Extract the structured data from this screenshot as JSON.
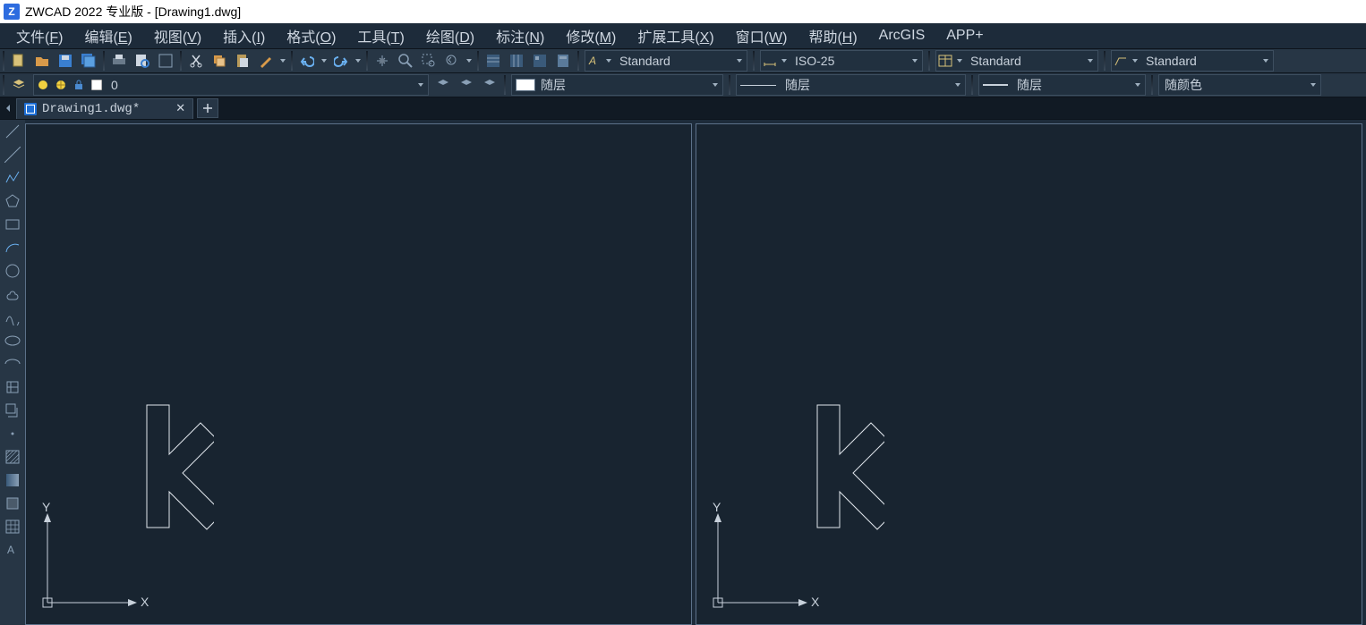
{
  "title": "ZWCAD 2022 专业版 - [Drawing1.dwg]",
  "logo_letter": "Z",
  "menu": [
    {
      "label": "文件",
      "u": "F",
      "suffix": ")"
    },
    {
      "label": "编辑",
      "u": "E",
      "suffix": ")"
    },
    {
      "label": "视图",
      "u": "V",
      "suffix": ")"
    },
    {
      "label": "插入",
      "u": "I",
      "suffix": ")"
    },
    {
      "label": "格式",
      "u": "O",
      "suffix": ")"
    },
    {
      "label": "工具",
      "u": "T",
      "suffix": ")"
    },
    {
      "label": "绘图",
      "u": "D",
      "suffix": ")"
    },
    {
      "label": "标注",
      "u": "N",
      "suffix": ")"
    },
    {
      "label": "修改",
      "u": "M",
      "suffix": ")"
    },
    {
      "label": "扩展工具",
      "u": "X",
      "suffix": ")"
    },
    {
      "label": "窗口",
      "u": "W",
      "suffix": ")"
    },
    {
      "label": "帮助",
      "u": "H",
      "suffix": ")"
    },
    {
      "label": "ArcGIS",
      "u": "",
      "suffix": ""
    },
    {
      "label": "APP+",
      "u": "",
      "suffix": ""
    }
  ],
  "combo": {
    "layer_value": "0",
    "text_style": "Standard",
    "dim_style": "ISO-25",
    "table_style": "Standard",
    "mleader_style": "Standard",
    "color_label": "随层",
    "linetype_label": "随层",
    "lineweight_label": "随层",
    "plotstyle_label": "随颜色"
  },
  "doctab": {
    "name": "Drawing1.dwg*"
  },
  "axis": {
    "x": "X",
    "y": "Y"
  }
}
